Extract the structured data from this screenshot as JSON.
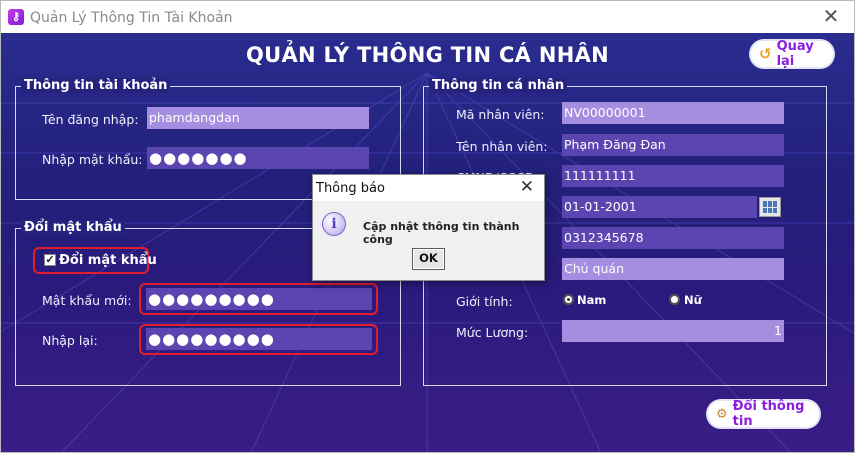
{
  "window": {
    "title": "Quản Lý Thông Tin Tài Khoản",
    "app_icon": "key-icon",
    "close_icon": "✕"
  },
  "header": {
    "page_title": "QUẢN LÝ THÔNG TIN CÁ NHÂN",
    "back_label": "Quay lại",
    "back_icon": "↺"
  },
  "account": {
    "legend": "Thông tin tài khoản",
    "username_label": "Tên đăng nhập:",
    "username_value": "phamdangdan",
    "password_label": "Nhập mật khẩu:",
    "password_value": "●●●●●●●"
  },
  "change_password": {
    "legend": "Đổi mật khẩu",
    "checkbox_label": "Đổi mật khẩu",
    "checked": true,
    "checkbox_mark": "✓",
    "new_password_label": "Mật khẩu mới:",
    "new_password_value": "●●●●●●●●●",
    "confirm_label": "Nhập lại:",
    "confirm_value": "●●●●●●●●●"
  },
  "personal": {
    "legend": "Thông tin cá nhân",
    "employee_id_label": "Mã nhân viên:",
    "employee_id_value": "NV00000001",
    "name_label": "Tên nhân viên:",
    "name_value": "Phạm Đăng Đan",
    "cmnd_label": "CMND/CCCD:",
    "cmnd_value": "111111111",
    "dob_value": "01-01-2001",
    "phone_value": "0312345678",
    "role_value": "Chủ quán",
    "gender_label": "Giới tính:",
    "gender_options": [
      "Nam",
      "Nữ"
    ],
    "gender_selected": "Nam",
    "salary_label": "Mức Lương:",
    "salary_value": "1"
  },
  "footer": {
    "update_label": "Đổi thông tin",
    "update_icon": "person-gear-icon"
  },
  "dialog": {
    "title": "Thông báo",
    "close": "✕",
    "icon": "i",
    "message": "Cập nhật thông tin thành công",
    "ok_label": "OK"
  },
  "colors": {
    "accent": "#8a1fe0",
    "field": "#a58de0",
    "field_dark": "#5b45b0",
    "highlight": "#e01e2c",
    "background_top": "#2a2c8f",
    "background_bottom": "#3a1d86"
  }
}
